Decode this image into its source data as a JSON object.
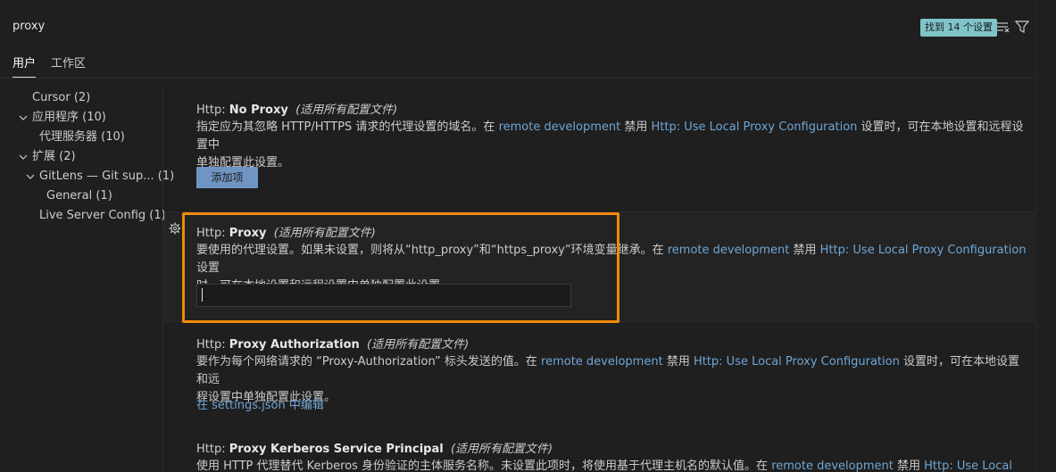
{
  "search": {
    "value": "proxy",
    "result_count": "找到 14 个设置"
  },
  "tabs": [
    {
      "label": "用户"
    },
    {
      "label": "工作区"
    }
  ],
  "tree": {
    "items": [
      {
        "label": "Cursor (2)"
      },
      {
        "label": "应用程序 (10)"
      },
      {
        "label": "代理服务器 (10)"
      },
      {
        "label": "扩展 (2)"
      },
      {
        "label": "GitLens — Git sup... (1)"
      },
      {
        "label": "General (1)"
      },
      {
        "label": "Live Server Config (1)"
      }
    ]
  },
  "settings": [
    {
      "category": "Http: ",
      "name": "No Proxy",
      "scope": "(适用所有配置文件)",
      "desc_line1_a": "指定应为其忽略 HTTP/HTTPS 请求的代理设置的域名。在 ",
      "desc_link1": "remote development",
      "desc_line1_b": " 禁用 ",
      "desc_link2": "Http: Use Local Proxy Configuration",
      "desc_line1_c": " 设置时，可在本地设置和远程设置中",
      "desc_line2": "单独配置此设置。",
      "button_label": "添加项"
    },
    {
      "category": "Http: ",
      "name": "Proxy",
      "scope": "(适用所有配置文件)",
      "desc_line1_a": "要使用的代理设置。如果未设置，则将从“http_proxy”和“https_proxy”环境变量继承。在 ",
      "desc_link1": "remote development",
      "desc_line1_b": " 禁用 ",
      "desc_link2": "Http: Use Local Proxy Configuration",
      "desc_line1_c": " 设置",
      "desc_line2": "时，可在本地设置和远程设置中单独配置此设置。",
      "input_value": ""
    },
    {
      "category": "Http: ",
      "name": "Proxy Authorization",
      "scope": "(适用所有配置文件)",
      "desc_line1_a": "要作为每个网络请求的 “Proxy-Authorization” 标头发送的值。在 ",
      "desc_link1": "remote development",
      "desc_line1_b": " 禁用 ",
      "desc_link2": "Http: Use Local Proxy Configuration",
      "desc_line1_c": " 设置时，可在本地设置和远",
      "desc_line2": "程设置中单独配置此设置。",
      "edit_link": "在 settings.json 中编辑"
    },
    {
      "category": "Http: ",
      "name": "Proxy Kerberos Service Principal",
      "scope": "(适用所有配置文件)",
      "desc_line1_a": "使用 HTTP 代理替代 Kerberos 身份验证的主体服务名称。未设置此项时，将使用基于代理主机名的默认值。在 ",
      "desc_link1": "remote development",
      "desc_line1_b": " 禁用 ",
      "desc_link2": "Http: Use Local"
    }
  ],
  "colors": {
    "accent_highlight": "#f08a0a",
    "link": "#6fa6d6",
    "badge": "#7fc4c9",
    "button": "#6f95c3"
  }
}
